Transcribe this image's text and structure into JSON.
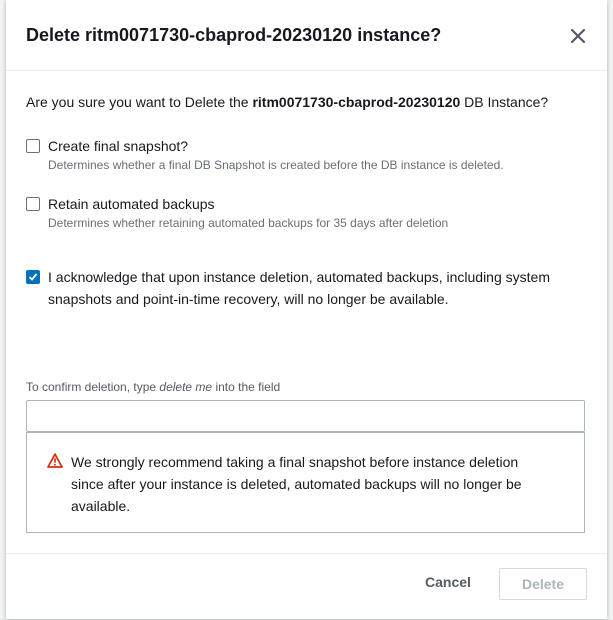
{
  "dialog": {
    "title": "Delete ritm0071730-cbaprod-20230120 instance?",
    "close_icon": "close-icon"
  },
  "question": {
    "prefix": "Are you sure you want to Delete the ",
    "instance": "ritm0071730-cbaprod-20230120",
    "suffix": " DB Instance?"
  },
  "options": [
    {
      "label": "Create final snapshot?",
      "description": "Determines whether a final DB Snapshot is created before the DB instance is deleted.",
      "checked": false
    },
    {
      "label": "Retain automated backups",
      "description": "Determines whether retaining automated backups for 35 days after deletion",
      "checked": false
    }
  ],
  "acknowledge": {
    "label": "I acknowledge that upon instance deletion, automated backups, including system snapshots and point-in-time recovery, will no longer be available.",
    "checked": true
  },
  "confirm": {
    "label_prefix": "To confirm deletion, type ",
    "label_keyword": "delete me",
    "label_suffix": " into the field",
    "value": "",
    "placeholder": ""
  },
  "alert": {
    "icon": "warning-icon",
    "text": "We strongly recommend taking a final snapshot before instance deletion since after your instance is deleted, automated backups will no longer be available."
  },
  "footer": {
    "cancel_label": "Cancel",
    "delete_label": "Delete",
    "delete_enabled": false
  },
  "colors": {
    "accent": "#0073bb",
    "warning": "#d13212",
    "disabled_text": "#aab7b8"
  }
}
